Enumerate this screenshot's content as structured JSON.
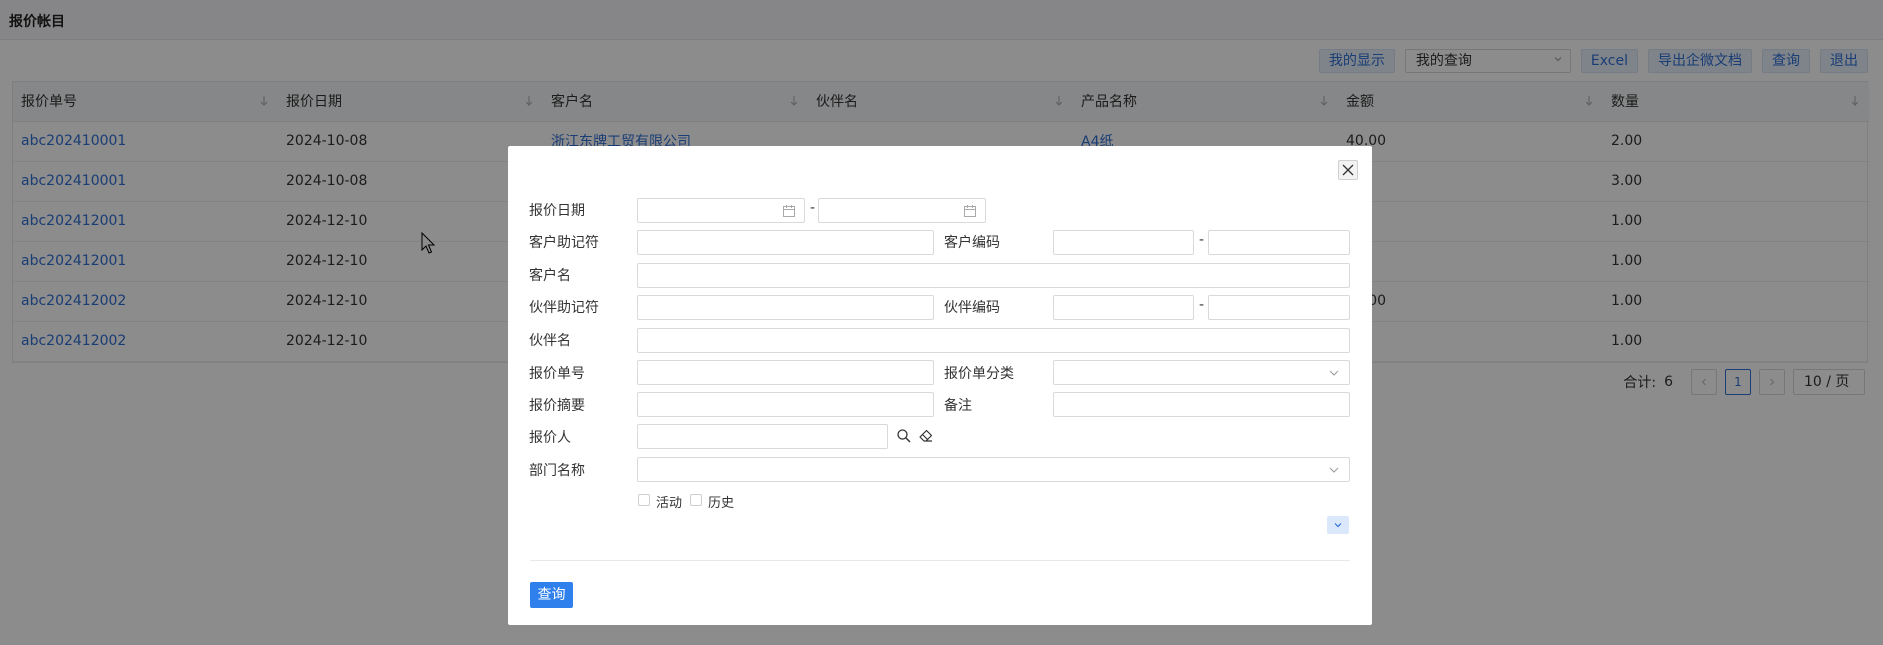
{
  "page": {
    "title": "报价帐目"
  },
  "toolbar": {
    "my_display": "我的显示",
    "my_query": "我的查询",
    "excel": "Excel",
    "export_doc": "导出企微文档",
    "query": "查询",
    "exit": "退出"
  },
  "table": {
    "columns": [
      "报价单号",
      "报价日期",
      "客户名",
      "伙伴名",
      "产品名称",
      "金额",
      "数量"
    ],
    "rows": [
      [
        "abc202410001",
        "2024-10-08",
        "浙江东牌工贸有限公司",
        "",
        "A4纸",
        "40.00",
        "2.00"
      ],
      [
        "abc202410001",
        "2024-10-08",
        "",
        "",
        "",
        ".00",
        "3.00"
      ],
      [
        "abc202412001",
        "2024-12-10",
        "",
        "",
        "",
        ".00",
        "1.00"
      ],
      [
        "abc202412001",
        "2024-12-10",
        "",
        "",
        "",
        "0",
        "1.00"
      ],
      [
        "abc202412002",
        "2024-12-10",
        "",
        "",
        "",
        "00.00",
        "1.00"
      ],
      [
        "abc202412002",
        "2024-12-10",
        "",
        "",
        "",
        "0",
        "1.00"
      ]
    ]
  },
  "pager": {
    "total_label": "合计:",
    "total": "6",
    "current_page": "1",
    "page_size": "10 / 页"
  },
  "modal": {
    "quote_date_label": "报价日期",
    "cust_mnemonic_label": "客户助记符",
    "cust_code_label": "客户编码",
    "cust_name_label": "客户名",
    "partner_mnemonic_label": "伙伴助记符",
    "partner_code_label": "伙伴编码",
    "partner_name_label": "伙伴名",
    "quote_no_label": "报价单号",
    "quote_category_label": "报价单分类",
    "quote_summary_label": "报价摘要",
    "remark_label": "备注",
    "quoter_label": "报价人",
    "dept_label": "部门名称",
    "active_label": "活动",
    "history_label": "历史",
    "range_sep": "-",
    "submit_label": "查询"
  },
  "icons": {
    "calendar": "calendar-icon",
    "search": "search-icon",
    "eraser": "eraser-icon",
    "close": "close-icon",
    "chevron": "chevron-down-icon",
    "sort": "sort-arrow-icon"
  },
  "colors": {
    "accent": "#2f80ed",
    "link": "#2f6fd6",
    "overlay": "rgba(0,0,0,0.45)"
  }
}
